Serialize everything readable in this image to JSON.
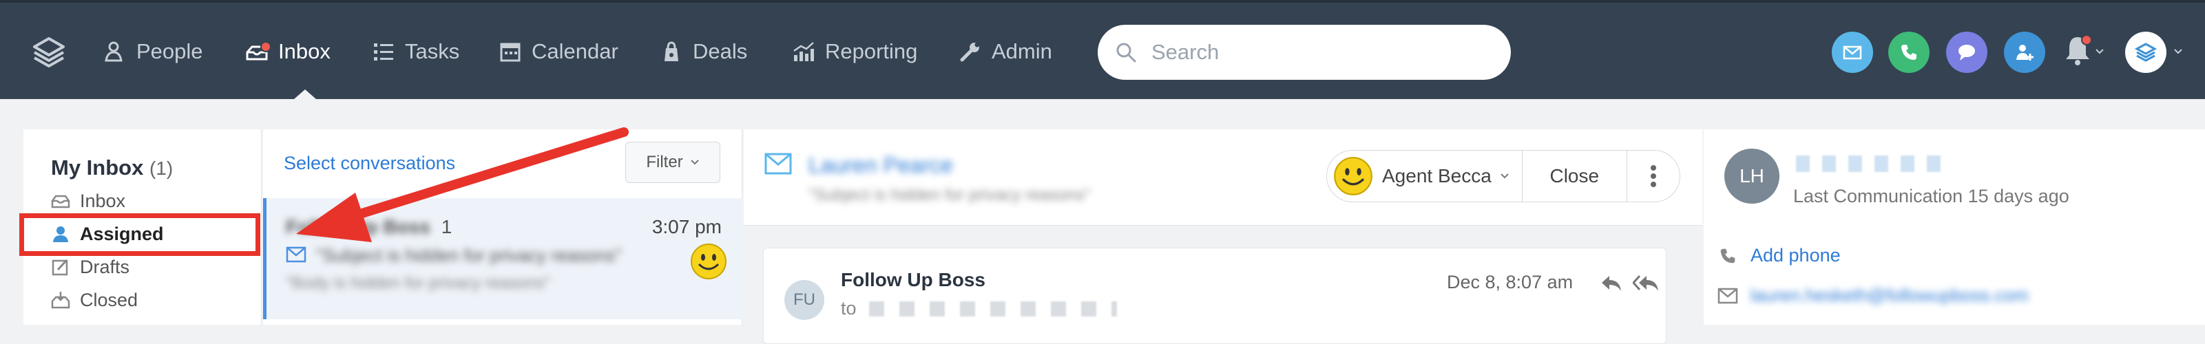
{
  "nav": {
    "items": [
      {
        "label": "People",
        "icon": "people-icon"
      },
      {
        "label": "Inbox",
        "icon": "inbox-icon"
      },
      {
        "label": "Tasks",
        "icon": "tasks-icon"
      },
      {
        "label": "Calendar",
        "icon": "calendar-icon"
      },
      {
        "label": "Deals",
        "icon": "deals-icon"
      },
      {
        "label": "Reporting",
        "icon": "reporting-icon"
      },
      {
        "label": "Admin",
        "icon": "admin-icon"
      }
    ],
    "active": "Inbox"
  },
  "search": {
    "placeholder": "Search"
  },
  "inbox": {
    "title": "My Inbox",
    "count": "(1)",
    "folders": [
      {
        "label": "Inbox",
        "icon": "inbox-tray-icon"
      },
      {
        "label": "Assigned",
        "icon": "user-icon"
      },
      {
        "label": "Drafts",
        "icon": "pencil-icon"
      },
      {
        "label": "Closed",
        "icon": "archive-icon"
      }
    ]
  },
  "conversations": {
    "select_label": "Select conversations",
    "filter_label": "Filter",
    "items": [
      {
        "sender": "Follow Up Boss",
        "count": "1",
        "time": "3:07 pm",
        "subject": "\"Subject is hidden for privacy reasons\"",
        "preview": "\"Body is hidden for privacy reasons\""
      }
    ]
  },
  "thread": {
    "contact_name": "Lauren Pearce",
    "subject": "\"Subject is hidden for privacy reasons\"",
    "agent_label": "Agent Becca",
    "close_label": "Close",
    "message": {
      "avatar_initials": "FU",
      "sender": "Follow Up Boss",
      "to_label": "to",
      "date": "Dec 8, 8:07 am"
    }
  },
  "contact": {
    "initials": "LH",
    "last_communication": "Last Communication 15 days ago",
    "add_phone_label": "Add phone",
    "email": "lauren.hesketh@followupboss.com"
  },
  "colors": {
    "nav_bg": "#344252",
    "accent_blue": "#2d7bd6",
    "highlight_red": "#e8332b"
  }
}
